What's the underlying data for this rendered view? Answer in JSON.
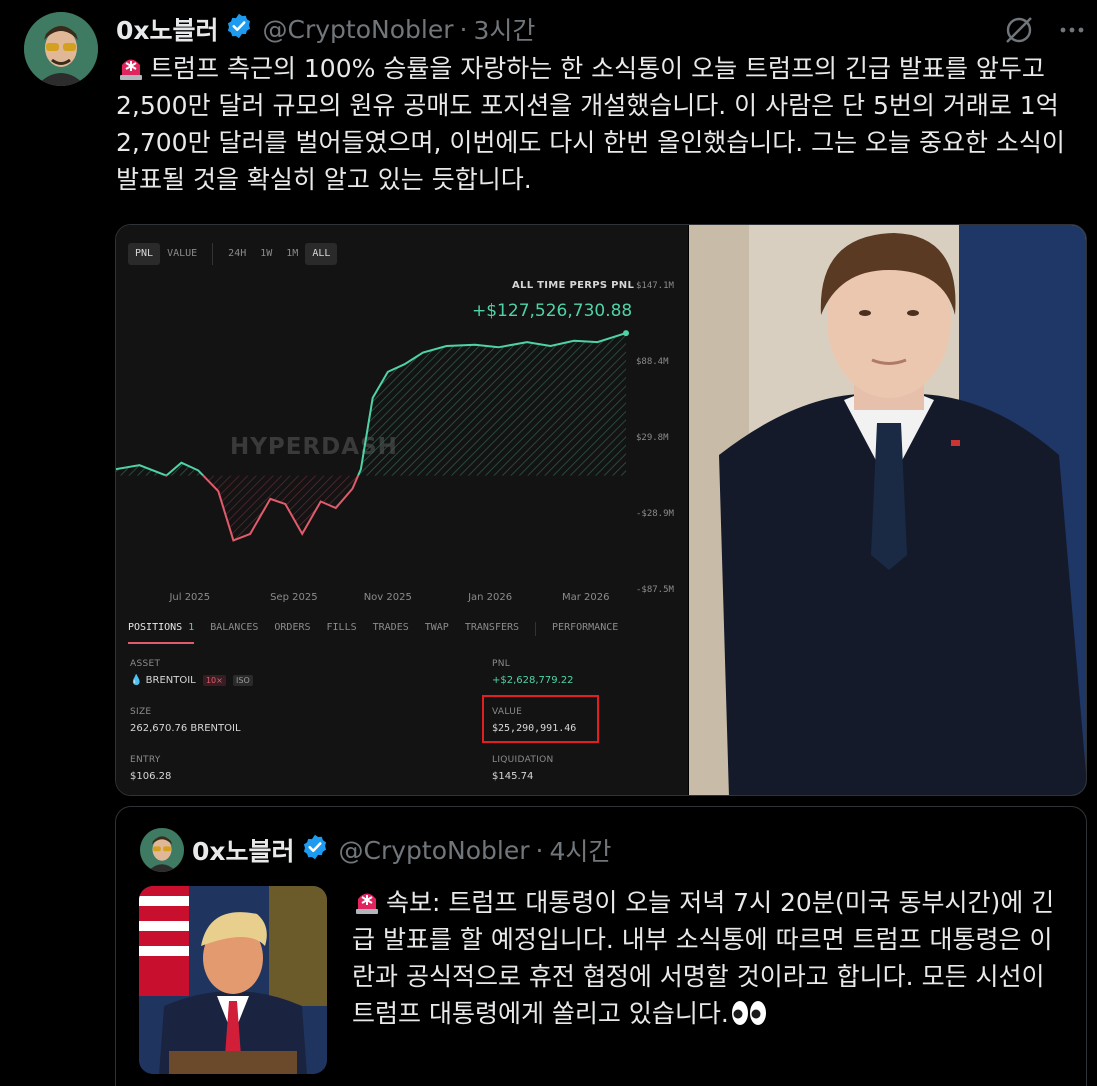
{
  "tweet": {
    "display_name": "0x노블러",
    "handle": "@CryptoNobler",
    "time": "3시간",
    "text": "트럼프 측근의 100% 승률을 자랑하는 한 소식통이 오늘 트럼프의 긴급 발표를 앞두고 2,500만 달러 규모의 원유 공매도 포지션을 개설했습니다. 이 사람은 단 5번의 거래로 1억 2,700만 달러를 벌어들였으며, 이번에도 다시 한번 올인했습니다. 그는 오늘 중요한 소식이 발표될 것을 확실히 알고 있는 듯합니다."
  },
  "dashboard": {
    "tabs": [
      "PNL",
      "VALUE",
      "24H",
      "1W",
      "1M",
      "ALL"
    ],
    "chart_title": "ALL TIME PERPS PNL",
    "chart_value": "+$127,526,730.88",
    "watermark": "HYPERDASH",
    "bottom_tabs": {
      "positions": "POSITIONS",
      "positions_count": "1",
      "items": [
        "BALANCES",
        "ORDERS",
        "FILLS",
        "TRADES",
        "TWAP",
        "TRANSFERS"
      ],
      "performance": "PERFORMANCE"
    },
    "fields": {
      "asset_label": "ASSET",
      "asset_value": "BRENTOIL",
      "asset_leverage": "10×",
      "asset_mode": "ISO",
      "pnl_label": "PNL",
      "pnl_value": "+$2,628,779.22",
      "size_label": "SIZE",
      "size_value": "262,670.76 BRENTOIL",
      "value_label": "VALUE",
      "value_value": "$25,290,991.46",
      "entry_label": "ENTRY",
      "entry_value": "$106.28",
      "liq_label": "LIQUIDATION",
      "liq_value": "$145.74"
    }
  },
  "chart_data": {
    "type": "line",
    "title": "ALL TIME PERPS PNL",
    "xlabel": "",
    "ylabel": "",
    "x_ticks": [
      "Jul 2025",
      "Sep 2025",
      "Nov 2025",
      "Jan 2026",
      "Mar 2026"
    ],
    "y_ticks": [
      "$147.1M",
      "$88.4M",
      "$29.8M",
      "-$28.9M",
      "-$87.5M"
    ],
    "ylim": [
      -87.5,
      147.1
    ],
    "grid": false,
    "legend": "none",
    "positive_color": "#4fd3a4",
    "negative_color": "#e05c6b",
    "x": [
      "2025-06-01",
      "2025-06-15",
      "2025-07-01",
      "2025-07-10",
      "2025-07-20",
      "2025-08-01",
      "2025-08-10",
      "2025-08-20",
      "2025-09-01",
      "2025-09-10",
      "2025-09-20",
      "2025-10-01",
      "2025-10-10",
      "2025-10-20",
      "2025-10-25",
      "2025-11-01",
      "2025-11-10",
      "2025-11-20",
      "2025-12-01",
      "2025-12-15",
      "2026-01-01",
      "2026-01-15",
      "2026-02-01",
      "2026-02-15",
      "2026-03-01",
      "2026-03-15",
      "2026-04-01"
    ],
    "values": [
      5,
      8,
      0,
      10,
      4,
      -12,
      -50,
      -45,
      -18,
      -22,
      -45,
      -20,
      -25,
      -10,
      5,
      60,
      80,
      86,
      95,
      100,
      101,
      99,
      103,
      100,
      104,
      103,
      110
    ]
  },
  "quote": {
    "display_name": "0x노블러",
    "handle": "@CryptoNobler",
    "time": "4시간",
    "text": "속보: 트럼프 대통령이 오늘 저녁 7시 20분(미국 동부시간)에 긴급 발표를 할 예정입니다. 내부 소식통에 따르면 트럼프 대통령은 이란과 공식적으로 휴전 협정에 서명할 것이라고 합니다. 모든 시선이 트럼프 대통령에게 쏠리고 있습니다."
  },
  "colors": {
    "background": "#000000",
    "verified": "#1d9bf0",
    "muted": "#71767b",
    "siren": "#e0245e"
  }
}
